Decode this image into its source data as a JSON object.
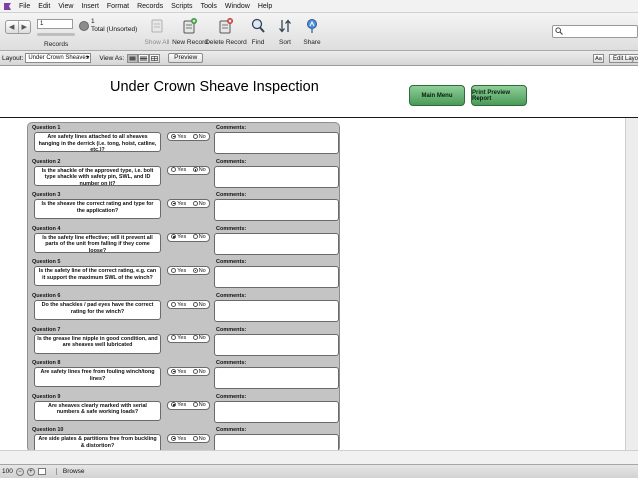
{
  "menubar": {
    "app_icon": "filemaker-icon",
    "items": [
      "File",
      "Edit",
      "View",
      "Insert",
      "Format",
      "Records",
      "Scripts",
      "Tools",
      "Window",
      "Help"
    ]
  },
  "toolbar": {
    "record_number": "1",
    "records_label": "Records",
    "total_count": "1",
    "total_label": "Total (Unsorted)",
    "buttons": {
      "show_all": "Show All",
      "new_record": "New Record",
      "delete_record": "Delete Record",
      "find": "Find",
      "sort": "Sort",
      "share": "Share"
    }
  },
  "layoutbar": {
    "layout_label": "Layout:",
    "layout_value": "Under Crown Sheaves",
    "view_as_label": "View As:",
    "preview_label": "Preview",
    "aa_label": "Aa",
    "edit_layout_label": "Edit Layout"
  },
  "header": {
    "title": "Under Crown Sheave Inspection",
    "main_menu_label": "Main Menu",
    "print_preview_label": "Print Preview Report"
  },
  "form": {
    "yes_label": "Yes",
    "no_label": "No",
    "comments_label": "Comments:",
    "questions": [
      {
        "label": "Question 1",
        "text": "Are safety lines attached to all sheaves hanging in the derrick (i.e. tong, hoist, catline, etc.)?",
        "answer": "yes"
      },
      {
        "label": "Question 2",
        "text": "Is the shackle of the approved type, i.e. bolt type shackle with safety pin, SWL, and ID number on it?",
        "answer": "no"
      },
      {
        "label": "Question 3",
        "text": "Is the sheave the correct rating and type for the application?",
        "answer": "yes"
      },
      {
        "label": "Question 4",
        "text": "Is the safety line effective; will it prevent all parts of the unit from falling if they come loose?",
        "answer": "yes"
      },
      {
        "label": "Question 5",
        "text": "Is the safety line of the correct rating, e.g. can it support the maximum SWL of the winch?",
        "answer": "no"
      },
      {
        "label": "Question 6",
        "text": "Do the shackles / pad eyes have the correct rating for the winch?",
        "answer": "none"
      },
      {
        "label": "Question 7",
        "text": "Is the grease line nipple in good condition, and are sheaves well lubricated",
        "answer": "none"
      },
      {
        "label": "Question 8",
        "text": "Are safety lines free from fouling winch/tong lines?",
        "answer": "yes"
      },
      {
        "label": "Question 9",
        "text": "Are sheaves clearly marked with serial numbers & safe working loads?",
        "answer": "yes"
      },
      {
        "label": "Question 10",
        "text": "Are side plates & partitions free from buckling & distortion?",
        "answer": "yes"
      }
    ]
  },
  "statusbar": {
    "zoom": "100",
    "mode": "Browse"
  },
  "colors": {
    "button_green": "#5aa866",
    "panel_gray": "#c4c4c4"
  }
}
